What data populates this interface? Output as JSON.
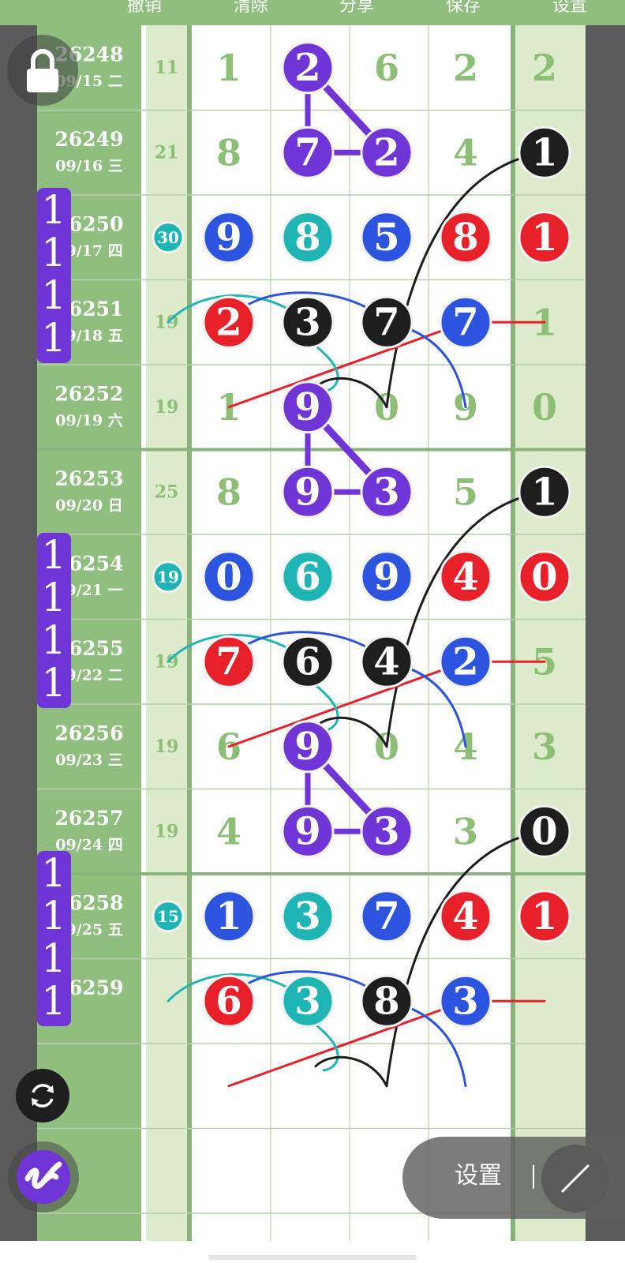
{
  "toolbar": {
    "undo_label": "撤销",
    "clear_label": "清除",
    "share_label": "分享",
    "save_label": "保存",
    "settings_label": "设置"
  },
  "rows": [
    {
      "issue": "26248",
      "date": "09/15 二",
      "total": "11",
      "digits": [
        "1",
        "2",
        "6",
        "2"
      ],
      "tail": "2"
    },
    {
      "issue": "26249",
      "date": "09/16 三",
      "total": "21",
      "digits": [
        "8",
        "7",
        "2",
        "4"
      ],
      "tail": "1"
    },
    {
      "issue": "26250",
      "date": "09/17 四",
      "total": "30",
      "digits": [
        "9",
        "8",
        "5",
        "8"
      ],
      "tail": "1"
    },
    {
      "issue": "26251",
      "date": "09/18 五",
      "total": "19",
      "digits": [
        "2",
        "3",
        "7",
        "7"
      ],
      "tail": "1"
    },
    {
      "issue": "26252",
      "date": "09/19 六",
      "total": "19",
      "digits": [
        "1",
        "9",
        "0",
        "9"
      ],
      "tail": "0"
    },
    {
      "issue": "26253",
      "date": "09/20 日",
      "total": "25",
      "digits": [
        "8",
        "9",
        "3",
        "5"
      ],
      "tail": "1"
    },
    {
      "issue": "26254",
      "date": "09/21 一",
      "total": "19",
      "digits": [
        "0",
        "6",
        "9",
        "4"
      ],
      "tail": "0"
    },
    {
      "issue": "26255",
      "date": "09/22 二",
      "total": "19",
      "digits": [
        "7",
        "6",
        "4",
        "2"
      ],
      "tail": "5"
    },
    {
      "issue": "26256",
      "date": "09/23 三",
      "total": "19",
      "digits": [
        "6",
        "9",
        "0",
        "4"
      ],
      "tail": "3"
    },
    {
      "issue": "26257",
      "date": "09/24 四",
      "total": "19",
      "digits": [
        "4",
        "9",
        "3",
        "3"
      ],
      "tail": "0"
    },
    {
      "issue": "26258",
      "date": "09/25 五",
      "total": "15",
      "digits": [
        "1",
        "3",
        "7",
        "4"
      ],
      "tail": "1"
    },
    {
      "issue": "26259",
      "date": "",
      "total": "",
      "digits": [
        "6",
        "3",
        "8",
        "3"
      ],
      "tail": ""
    }
  ],
  "markers": [
    {
      "chars": [
        "1",
        "1",
        "1",
        "1"
      ]
    },
    {
      "chars": [
        "1",
        "1",
        "1",
        "1"
      ]
    },
    {
      "chars": [
        "1",
        "1",
        "1",
        "1"
      ]
    }
  ],
  "settings_panel": {
    "label": "设置"
  },
  "icons": {
    "lock": "lock-icon",
    "refresh": "refresh-icon",
    "pen_app": "pen-app-icon",
    "draw": "draw-line-icon"
  },
  "colors": {
    "header_green": "#8fbe7e",
    "light_green": "#dcebc9",
    "digit_green": "#8cbe76",
    "purple": "#7035d6",
    "teal": "#20b5b5",
    "blue": "#2d54de",
    "red": "#e8202a",
    "black": "#1e1e1e"
  }
}
